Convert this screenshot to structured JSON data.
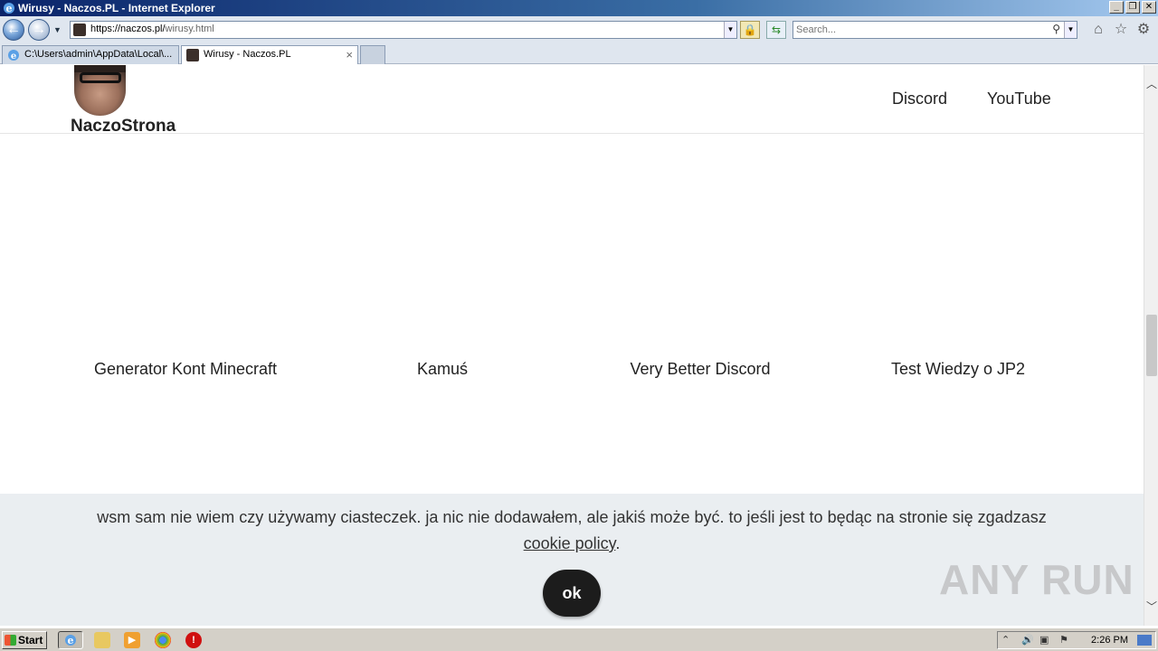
{
  "window": {
    "title": "Wirusy - Naczos.PL - Internet Explorer"
  },
  "address_bar": {
    "url_host": "https://naczos.pl/",
    "url_path": "wirusy.html"
  },
  "search": {
    "placeholder": "Search..."
  },
  "tabs": [
    {
      "label": "C:\\Users\\admin\\AppData\\Local\\..."
    },
    {
      "label": "Wirusy - Naczos.PL"
    }
  ],
  "site": {
    "brand": "NaczoStrona",
    "nav": [
      {
        "label": "Discord"
      },
      {
        "label": "YouTube"
      }
    ]
  },
  "products": [
    {
      "title": "Generator Kont Minecraft"
    },
    {
      "title": "Kamuś"
    },
    {
      "title": "Very Better Discord"
    },
    {
      "title": "Test Wiedzy o JP2"
    }
  ],
  "cookie": {
    "text_before": "wsm sam nie wiem czy używamy ciasteczek. ja nic nie dodawałem, ale jakiś może być. to jeśli jest to będąc na stronie się zgadzasz ",
    "link": "cookie policy",
    "text_after": ".",
    "ok_label": "ok"
  },
  "watermark": "ANY RUN",
  "taskbar": {
    "start_label": "Start",
    "clock": "2:26 PM"
  }
}
